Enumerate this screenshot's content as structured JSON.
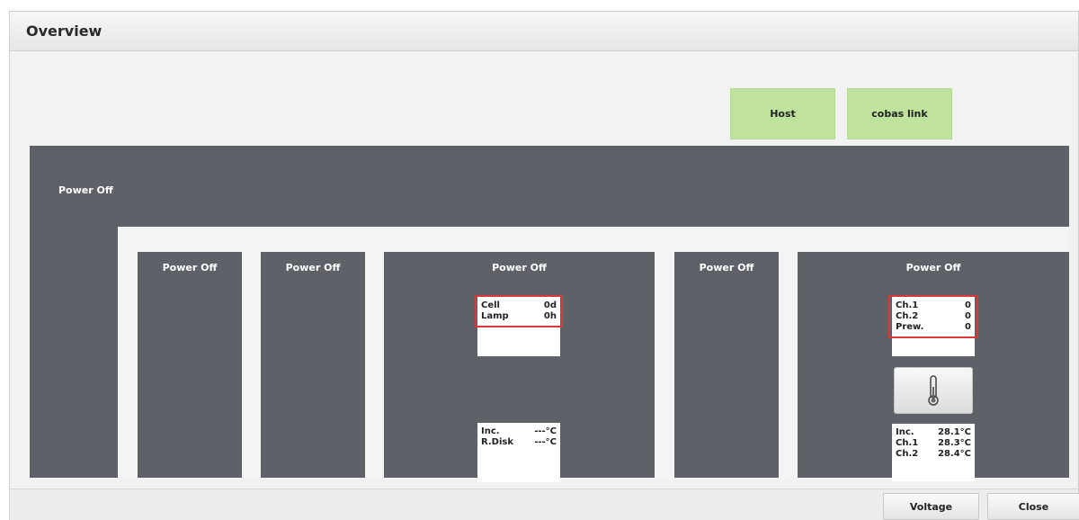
{
  "window": {
    "title": "Overview"
  },
  "top_buttons": {
    "host": "Host",
    "cobas_link": "cobas link"
  },
  "main": {
    "outer_status": "Power Off",
    "modules": [
      {
        "status": "Power Off"
      },
      {
        "status": "Power Off"
      },
      {
        "status": "Power Off",
        "info": [
          {
            "label": "Cell",
            "value": "0d"
          },
          {
            "label": "Lamp",
            "value": "0h"
          }
        ],
        "temps": [
          {
            "label": "Inc.",
            "value": "---°C"
          },
          {
            "label": "R.Disk",
            "value": "---°C"
          }
        ]
      },
      {
        "status": "Power Off"
      },
      {
        "status": "Power Off",
        "info": [
          {
            "label": "Ch.1",
            "value": "0"
          },
          {
            "label": "Ch.2",
            "value": "0"
          },
          {
            "label": "Prew.",
            "value": "0"
          }
        ],
        "temps": [
          {
            "label": "Inc.",
            "value": "28.1°C"
          },
          {
            "label": "Ch.1",
            "value": "28.3°C"
          },
          {
            "label": "Ch.2",
            "value": "28.4°C"
          }
        ]
      }
    ]
  },
  "footer": {
    "voltage": "Voltage",
    "close": "Close"
  },
  "icons": {
    "thermometer": "thermometer-icon"
  },
  "colors": {
    "panel": "#5e6168",
    "green_button": "#bfe39c",
    "highlight": "#d83a3a"
  }
}
